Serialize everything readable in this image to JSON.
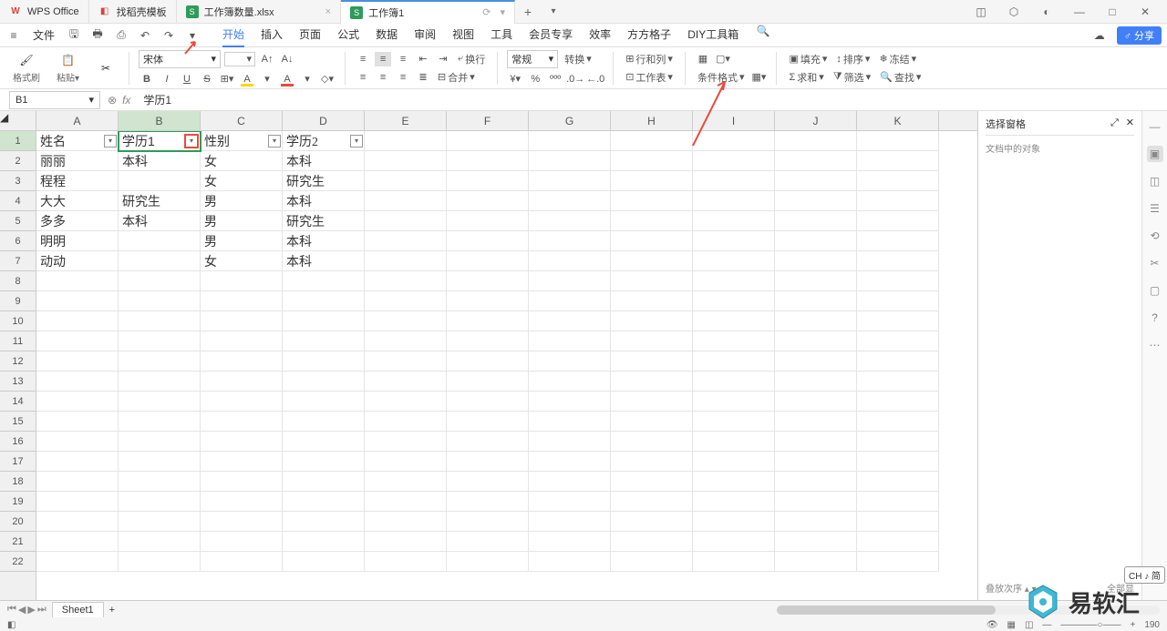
{
  "tabs": [
    {
      "icon": "wps",
      "label": "WPS Office"
    },
    {
      "icon": "c",
      "label": "找稻壳模板"
    },
    {
      "icon": "s",
      "label": "工作簿数量.xlsx"
    },
    {
      "icon": "s",
      "label": "工作簿1"
    }
  ],
  "menu": {
    "file": "文件",
    "items": [
      "开始",
      "插入",
      "页面",
      "公式",
      "数据",
      "审阅",
      "视图",
      "工具",
      "会员专享",
      "效率",
      "方方格子",
      "DIY工具箱"
    ],
    "share": "分享"
  },
  "ribbon": {
    "format_painter": "格式刷",
    "paste": "粘贴",
    "font": "宋体",
    "size_up": "A^",
    "size_down": "A˅",
    "wrap": "换行",
    "merge": "合并",
    "general": "常规",
    "convert": "转换",
    "rc": "行和列",
    "worksheet": "工作表",
    "cond": "条件格式",
    "fill": "填充",
    "sort": "排序",
    "freeze": "冻结",
    "sum": "求和",
    "filter": "筛选",
    "find": "查找"
  },
  "namebox": "B1",
  "formula": "学历1",
  "columns": [
    "A",
    "B",
    "C",
    "D",
    "E",
    "F",
    "G",
    "H",
    "I",
    "J",
    "K"
  ],
  "rows": [
    1,
    2,
    3,
    4,
    5,
    6,
    7,
    8,
    9,
    10,
    11,
    12,
    13,
    14,
    15,
    16,
    17,
    18,
    19,
    20,
    21,
    22
  ],
  "data": {
    "r1": {
      "A": "姓名",
      "B": "学历1",
      "C": "性别",
      "D": "学历2"
    },
    "r2": {
      "A": "丽丽",
      "B": "本科",
      "C": "女",
      "D": "本科"
    },
    "r3": {
      "A": "程程",
      "B": "",
      "C": "女",
      "D": "研究生"
    },
    "r4": {
      "A": "大大",
      "B": "研究生",
      "C": "男",
      "D": "本科"
    },
    "r5": {
      "A": "多多",
      "B": "本科",
      "C": "男",
      "D": "研究生"
    },
    "r6": {
      "A": "明明",
      "B": "",
      "C": "男",
      "D": "本科"
    },
    "r7": {
      "A": "动动",
      "B": "",
      "C": "女",
      "D": "本科"
    }
  },
  "pane": {
    "title": "选择窗格",
    "sub": "文档中的对象",
    "stack": "叠放次序",
    "all": "全部显"
  },
  "sheet": "Sheet1",
  "status": {
    "zoom": "190"
  },
  "ch_badge": "CH ♪ 简",
  "watermark": "易软汇"
}
